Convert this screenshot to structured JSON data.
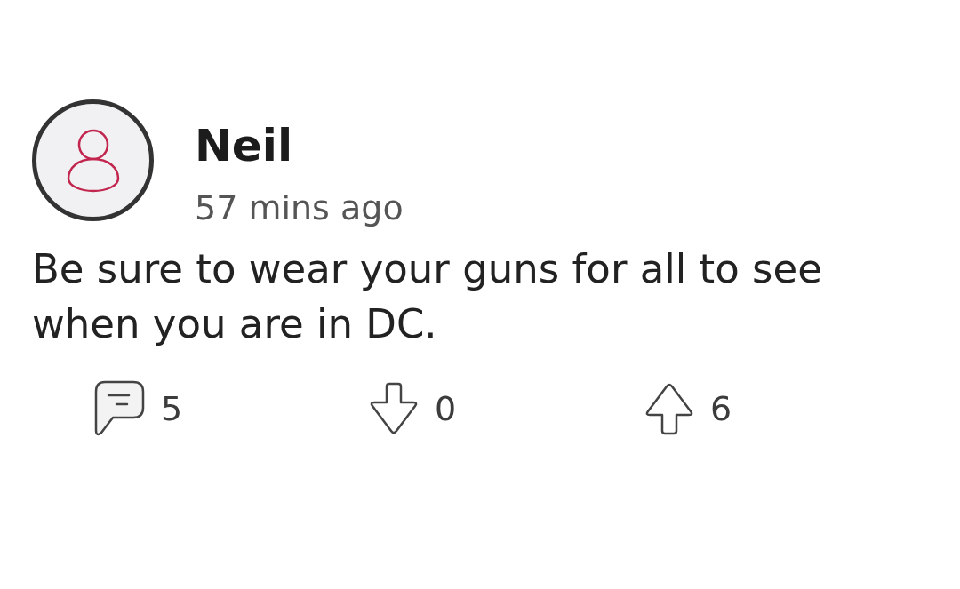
{
  "post": {
    "author": "Neil",
    "time": "57 mins ago",
    "body": "Be sure to wear your guns for all to see when you are in DC."
  },
  "actions": [
    {
      "kind": "comments",
      "count": "5"
    },
    {
      "kind": "downvote",
      "count": "0"
    },
    {
      "kind": "upvote",
      "count": "6"
    }
  ]
}
